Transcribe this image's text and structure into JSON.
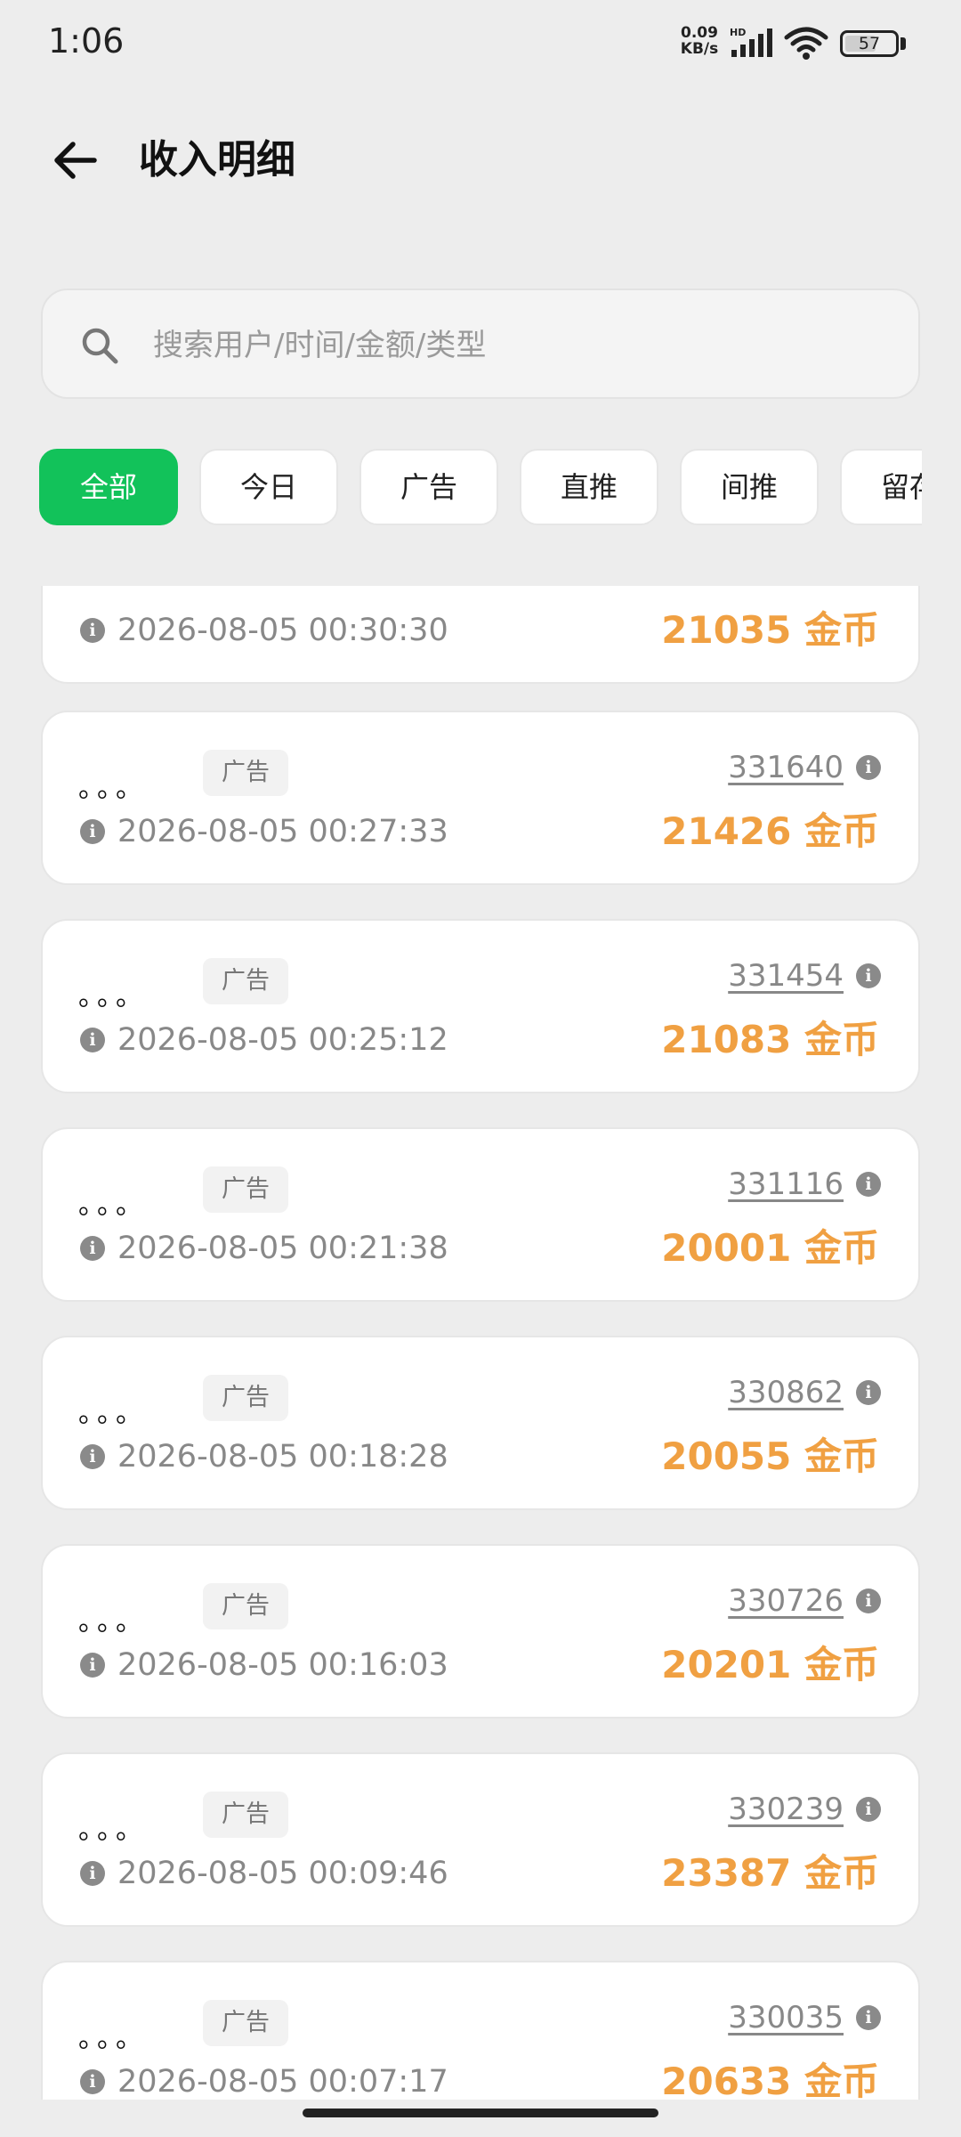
{
  "status_bar": {
    "time": "1:06",
    "net_speed_value": "0.09",
    "net_speed_unit": "KB/s",
    "network_type": "HD",
    "battery": "57"
  },
  "header": {
    "title": "收入明细"
  },
  "search": {
    "placeholder": "搜索用户/时间/金额/类型"
  },
  "filters": [
    {
      "label": "全部",
      "active": true
    },
    {
      "label": "今日",
      "active": false
    },
    {
      "label": "广告",
      "active": false
    },
    {
      "label": "直推",
      "active": false
    },
    {
      "label": "间推",
      "active": false
    },
    {
      "label": "留存",
      "active": false
    }
  ],
  "colors": {
    "accent_green": "#12c25a",
    "amount_orange": "#f0a042",
    "background": "#ededed"
  },
  "records": [
    {
      "name": "",
      "tag": "",
      "time": "2026-08-05 00:30:30",
      "id": "",
      "amount": "21035 金币"
    },
    {
      "name": "。。。",
      "tag": "广告",
      "time": "2026-08-05 00:27:33",
      "id": "331640",
      "amount": "21426 金币"
    },
    {
      "name": "。。。",
      "tag": "广告",
      "time": "2026-08-05 00:25:12",
      "id": "331454",
      "amount": "21083 金币"
    },
    {
      "name": "。。。",
      "tag": "广告",
      "time": "2026-08-05 00:21:38",
      "id": "331116",
      "amount": "20001 金币"
    },
    {
      "name": "。。。",
      "tag": "广告",
      "time": "2026-08-05 00:18:28",
      "id": "330862",
      "amount": "20055 金币"
    },
    {
      "name": "。。。",
      "tag": "广告",
      "time": "2026-08-05 00:16:03",
      "id": "330726",
      "amount": "20201 金币"
    },
    {
      "name": "。。。",
      "tag": "广告",
      "time": "2026-08-05 00:09:46",
      "id": "330239",
      "amount": "23387 金币"
    },
    {
      "name": "。。。",
      "tag": "广告",
      "time": "2026-08-05 00:07:17",
      "id": "330035",
      "amount": "20633 金币"
    }
  ]
}
